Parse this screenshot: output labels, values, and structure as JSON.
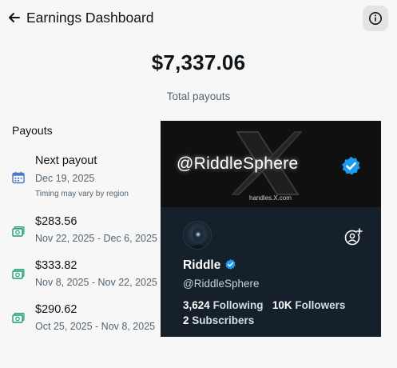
{
  "header": {
    "title": "Earnings Dashboard"
  },
  "summary": {
    "total_amount": "$7,337.06",
    "total_label": "Total payouts"
  },
  "payouts": {
    "heading": "Payouts",
    "next": {
      "title": "Next payout",
      "date": "Dec 19, 2025",
      "note": "Timing may vary by region"
    },
    "items": [
      {
        "amount": "$283.56",
        "period": "Nov 22, 2025 - Dec 6, 2025"
      },
      {
        "amount": "$333.82",
        "period": "Nov 8, 2025 - Nov 22, 2025"
      },
      {
        "amount": "$290.62",
        "period": "Oct 25, 2025 - Nov 8, 2025"
      }
    ]
  },
  "profile_card": {
    "banner_handle": "@RiddleSphere",
    "banner_site": "handles.X.com",
    "name": "Riddle",
    "handle": "@RiddleSphere",
    "following_count": "3,624",
    "following_label": "Following",
    "followers_count": "10K",
    "followers_label": "Followers",
    "subscribers_count": "2",
    "subscribers_label": "Subscribers"
  },
  "colors": {
    "verified_blue": "#1d9bf0",
    "money_green": "#1a9c73",
    "card_bg": "#15202b",
    "calendar_blue": "#4a79c8"
  },
  "icons": [
    "arrow-left-icon",
    "info-icon",
    "calendar-icon",
    "money-icon",
    "verified-badge-icon",
    "add-user-icon",
    "x-logo-icon"
  ]
}
